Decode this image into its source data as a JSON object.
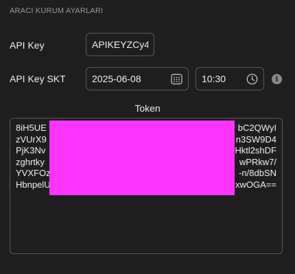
{
  "section": {
    "title": "ARACI KURUM AYARLARI"
  },
  "api_key": {
    "label": "API Key",
    "value": "APIKEYZCy4"
  },
  "api_key_skt": {
    "label": "API Key SKT",
    "date": "2025-06-08",
    "time": "10:30"
  },
  "token": {
    "label": "Token",
    "lines": [
      {
        "left": "8iH5UE",
        "right": "bC2QWyI"
      },
      {
        "left": "zVUrX9",
        "right": "n3SW9D4"
      },
      {
        "left": "PjK3Nv",
        "right": "Hktl2shDF"
      },
      {
        "left": "zghrtky",
        "right": "wPRkw7/"
      },
      {
        "left": "YVXFOz",
        "right": "-n/8dbSN"
      },
      {
        "left": "HbnpelU",
        "right": "xwOGA=="
      }
    ]
  },
  "colors": {
    "redaction": "#ff33ff",
    "background": "#1e1e1e"
  },
  "icons": {
    "date_picker": "calendar-icon",
    "time_picker": "clock-icon",
    "info": "info-icon"
  }
}
